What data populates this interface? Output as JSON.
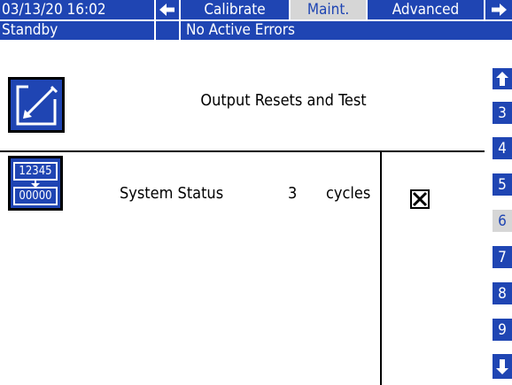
{
  "header": {
    "datetime": "03/13/20 16:02",
    "tabs": [
      {
        "label": "Calibrate",
        "active": false
      },
      {
        "label": "Maint.",
        "active": true
      },
      {
        "label": "Advanced",
        "active": false
      }
    ],
    "status": "Standby",
    "errors": "No Active Errors",
    "prev_icon": "arrow-left-icon",
    "next_icon": "arrow-right-icon"
  },
  "screen": {
    "title": "Output Resets and Test",
    "edit_icon": "edit-pencil-icon"
  },
  "rows": [
    {
      "icon": "counter-reset-icon",
      "counter_top": "12345",
      "counter_bottom": "00000",
      "label": "System Status",
      "value": "3",
      "unit": "cycles",
      "checked": true
    }
  ],
  "sidebar": {
    "up_icon": "arrow-up-icon",
    "down_icon": "arrow-down-icon",
    "pages": [
      "3",
      "4",
      "5",
      "6",
      "7",
      "8",
      "9"
    ],
    "active_page": "6"
  },
  "colors": {
    "accent": "#1f45b3",
    "active_bg": "#d6d6d6"
  }
}
